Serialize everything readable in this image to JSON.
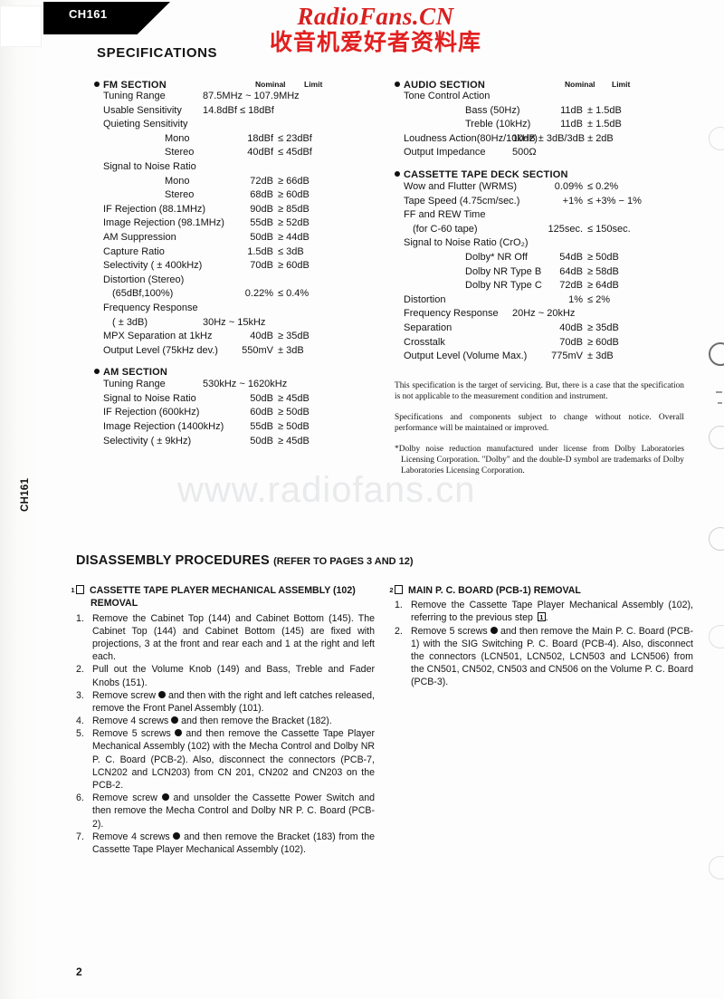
{
  "document": {
    "model_tab": "CH161",
    "side_tab": "CH161",
    "page_number": "2"
  },
  "watermark": {
    "red_line1": "RadioFans.CN",
    "red_line2": "收音机爱好者资料库",
    "grey": "www.radiofans.cn",
    "red_color": "#d91f1f",
    "grey_color": "#e9eaec"
  },
  "specifications": {
    "heading": "SPECIFICATIONS",
    "column_headers": {
      "nominal": "Nominal",
      "limit": "Limit"
    },
    "sections": [
      {
        "title": "FM SECTION",
        "rows": [
          {
            "label": "Tuning Range",
            "indent": 1,
            "wide": "87.5MHz ~ 107.9MHz"
          },
          {
            "label": "Usable Sensitivity",
            "indent": 1,
            "wide": "14.8dBf  ≤  18dBf"
          },
          {
            "label": "Quieting Sensitivity",
            "indent": 1
          },
          {
            "label": "Mono",
            "indent": 2,
            "nominal": "18dBf",
            "limit": "≤  23dBf"
          },
          {
            "label": "Stereo",
            "indent": 2,
            "nominal": "40dBf",
            "limit": "≤  45dBf"
          },
          {
            "label": "Signal to Noise Ratio",
            "indent": 1
          },
          {
            "label": "Mono",
            "indent": 2,
            "nominal": "72dB",
            "limit": "≥  66dB"
          },
          {
            "label": "Stereo",
            "indent": 2,
            "nominal": "68dB",
            "limit": "≥  60dB"
          },
          {
            "label": "IF Rejection (88.1MHz)",
            "indent": 1,
            "nominal": "90dB",
            "limit": "≥  85dB"
          },
          {
            "label": "Image Rejection (98.1MHz)",
            "indent": 1,
            "nominal": "55dB",
            "limit": "≥  52dB"
          },
          {
            "label": "AM Suppression",
            "indent": 1,
            "nominal": "50dB",
            "limit": "≥  44dB"
          },
          {
            "label": "Capture Ratio",
            "indent": 1,
            "nominal": "1.5dB",
            "limit": "≤  3dB"
          },
          {
            "label": "Selectivity ( ± 400kHz)",
            "indent": 1,
            "nominal": "70dB",
            "limit": "≥  60dB"
          },
          {
            "label": "Distortion (Stereo)",
            "indent": 1
          },
          {
            "label": "(65dBf,100%)",
            "indent": 3,
            "nominal": "0.22%",
            "limit": "≤  0.4%"
          },
          {
            "label": "Frequency Response",
            "indent": 1
          },
          {
            "label": "( ± 3dB)",
            "indent": 3,
            "wide": "30Hz ~ 15kHz"
          },
          {
            "label": "MPX Separation at 1kHz",
            "indent": 1,
            "nominal": "40dB",
            "limit": "≥  35dB"
          },
          {
            "label": "Output Level (75kHz dev.)",
            "indent": 1,
            "nominal": "550mV",
            "limit": "± 3dB"
          }
        ]
      },
      {
        "title": "AM SECTION",
        "rows": [
          {
            "label": "Tuning Range",
            "indent": 1,
            "wide": "530kHz ~ 1620kHz"
          },
          {
            "label": "Signal to Noise Ratio",
            "indent": 1,
            "nominal": "50dB",
            "limit": "≥  45dB"
          },
          {
            "label": "IF Rejection (600kHz)",
            "indent": 1,
            "nominal": "60dB",
            "limit": "≥  50dB"
          },
          {
            "label": "Image Rejection (1400kHz)",
            "indent": 1,
            "nominal": "55dB",
            "limit": "≥  50dB"
          },
          {
            "label": "Selectivity ( ± 9kHz)",
            "indent": 1,
            "nominal": "50dB",
            "limit": "≥  45dB"
          }
        ]
      }
    ],
    "sections_right": [
      {
        "title": "AUDIO SECTION",
        "rows": [
          {
            "label": "Tone Control Action",
            "indent": 1
          },
          {
            "label": "Bass (50Hz)",
            "indent": 2,
            "nominal": "11dB",
            "limit": "± 1.5dB"
          },
          {
            "label": "Treble (10kHz)",
            "indent": 2,
            "nominal": "11dB",
            "limit": "± 1.5dB"
          },
          {
            "label": "Loudness Action(80Hz/10kHz)",
            "indent": 1,
            "wide": "10dB ± 3dB/3dB ± 2dB"
          },
          {
            "label": "Output Impedance",
            "indent": 1,
            "wide": "500Ω"
          }
        ]
      },
      {
        "title": "CASSETTE TAPE DECK SECTION",
        "rows": [
          {
            "label": "Wow and Flutter (WRMS)",
            "indent": 1,
            "nominal": "0.09%",
            "limit": "≤  0.2%"
          },
          {
            "label": "Tape Speed (4.75cm/sec.)",
            "indent": 1,
            "nominal": "+1%",
            "limit": "≤  +3%  − 1%"
          },
          {
            "label": "FF and REW Time",
            "indent": 1
          },
          {
            "label": "(for C-60 tape)",
            "indent": 3,
            "nominal": "125sec.",
            "limit": "≤  150sec."
          },
          {
            "label": "Signal to Noise Ratio (CrO₂)",
            "indent": 1
          },
          {
            "label": "Dolby* NR Off",
            "indent": 2,
            "nominal": "54dB",
            "limit": "≥  50dB"
          },
          {
            "label": "Dolby NR Type B",
            "indent": 2,
            "nominal": "64dB",
            "limit": "≥  58dB"
          },
          {
            "label": "Dolby NR Type C",
            "indent": 2,
            "nominal": "72dB",
            "limit": "≥  64dB"
          },
          {
            "label": "Distortion",
            "indent": 1,
            "nominal": "1%",
            "limit": "≤  2%"
          },
          {
            "label": "Frequency Response",
            "indent": 1,
            "wide": "20Hz ~ 20kHz"
          },
          {
            "label": "Separation",
            "indent": 1,
            "nominal": "40dB",
            "limit": "≥  35dB"
          },
          {
            "label": "Crosstalk",
            "indent": 1,
            "nominal": "70dB",
            "limit": "≥  60dB"
          },
          {
            "label": "Output Level (Volume Max.)",
            "indent": 1,
            "nominal": "775mV",
            "limit": "± 3dB"
          }
        ]
      }
    ],
    "notes": [
      "This specification is the target of servicing. But, there is a case that the specification is not applicable to the measurement condition and instrument.",
      "Specifications and components subject to change without notice. Overall performance will be maintained or improved.",
      "*Dolby noise reduction manufactured under license from Dolby Laboratories Licensing Corporation. \"Dolby\" and the double-D symbol are trademarks of Dolby Laboratories Licensing Corporation."
    ]
  },
  "disassembly": {
    "heading": "DISASSEMBLY PROCEDURES",
    "heading_sub": "(REFER TO PAGES 3 AND 12)",
    "left": {
      "number": "1",
      "title": "CASSETTE TAPE PLAYER MECHANICAL ASSEMBLY (102) REMOVAL",
      "steps": [
        "Remove the Cabinet Top (144) and Cabinet Bottom (145). The Cabinet Top (144) and Cabinet Bottom (145) are fixed with projections, 3 at the front and rear each and 1 at the right and left each.",
        "Pull out the Volume Knob (149) and Bass, Treble and Fader Knobs (151).",
        "Remove screw ❶ and then with the right and left catches released, remove the Front Panel Assembly (101).",
        "Remove 4 screws ❷ and then remove the Bracket (182).",
        "Remove 5 screws ❸ and then remove the Cassette Tape Player Mechanical Assembly (102) with the Mecha Control and Dolby NR P. C. Board (PCB-2). Also, disconnect the connectors (PCB-7, LCN202 and LCN203) from CN 201, CN202 and CN203 on the PCB-2.",
        "Remove screw ❹ and unsolder the Cassette Power Switch and then remove the Mecha Control and Dolby NR P. C. Board (PCB-2).",
        "Remove 4 screws ❺ and then remove the Bracket (183) from the Cassette Tape Player Mechanical Assembly (102)."
      ]
    },
    "right": {
      "number": "2",
      "title": "MAIN P. C. BOARD (PCB-1) REMOVAL",
      "steps": [
        "Remove the Cassette Tape Player Mechanical Assembly (102), referring to the previous step 1.",
        "Remove 5 screws ❻ and then remove the Main P. C. Board (PCB-1) with the SIG Switching P. C. Board (PCB-4). Also, disconnect the connectors (LCN501, LCN502, LCN503 and LCN506) from the CN501, CN502, CN503 and CN506 on the Volume P. C. Board (PCB-3)."
      ]
    }
  }
}
